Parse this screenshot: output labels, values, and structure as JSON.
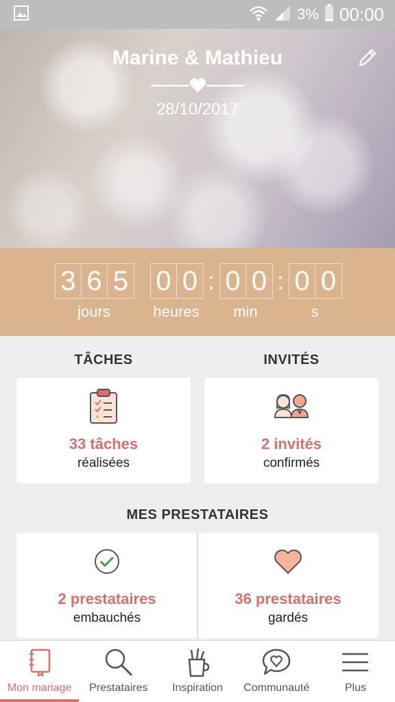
{
  "status_bar": {
    "battery": "3%",
    "time": "00:00"
  },
  "hero": {
    "couple": "Marine & Mathieu",
    "date": "28/10/2017"
  },
  "countdown": {
    "days": [
      "3",
      "6",
      "5"
    ],
    "hours": [
      "0",
      "0"
    ],
    "minutes": [
      "0",
      "0"
    ],
    "seconds": [
      "0",
      "0"
    ],
    "labels": {
      "days": "jours",
      "hours": "heures",
      "minutes": "min",
      "seconds": "s"
    }
  },
  "tasks": {
    "title": "TÂCHES",
    "value": "33 tâches",
    "sub": "réalisées"
  },
  "guests": {
    "title": "INVITÉS",
    "value": "2 invités",
    "sub": "confirmés"
  },
  "vendors": {
    "title": "MES PRESTATAIRES",
    "hired": {
      "value": "2 prestataires",
      "sub": "embauchés"
    },
    "saved": {
      "value": "36 prestataires",
      "sub": "gardés"
    }
  },
  "nav": [
    {
      "label": "Mon mariage",
      "icon": "notebook-icon"
    },
    {
      "label": "Prestataires",
      "icon": "search-icon"
    },
    {
      "label": "Inspiration",
      "icon": "pencil-cup-icon"
    },
    {
      "label": "Communauté",
      "icon": "heart-chat-icon"
    },
    {
      "label": "Plus",
      "icon": "menu-icon"
    }
  ],
  "colors": {
    "accent": "#d9706f",
    "countdown_bg": "#d9b48f",
    "status_bar": "#bdbdbd"
  }
}
